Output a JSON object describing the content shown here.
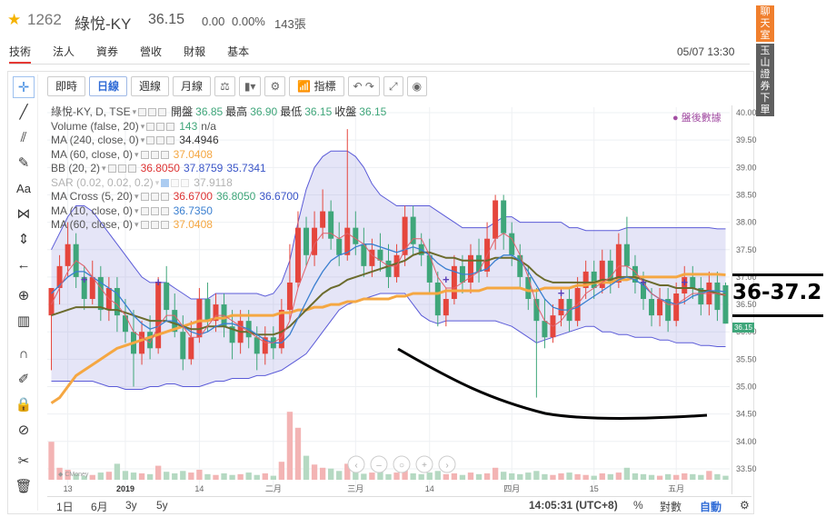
{
  "header": {
    "code": "1262",
    "name": "綠悅-KY",
    "price": "36.15",
    "change": "0.00",
    "pct": "0.00%",
    "volume": "143張",
    "datetime": "05/07 13:30"
  },
  "tabs": [
    "技術",
    "法人",
    "資券",
    "營收",
    "財報",
    "基本"
  ],
  "side_buttons": {
    "chat": "聊天室",
    "order": "玉山證券下單"
  },
  "toolbar": {
    "intraday": "即時",
    "daily": "日線",
    "weekly": "週線",
    "monthly": "月線",
    "indicator": "指標"
  },
  "legend": {
    "ohlc": {
      "title": "綠悅-KY, D, TSE",
      "open_l": "開盤",
      "open": "36.85",
      "high_l": "最高",
      "high": "36.90",
      "low_l": "最低",
      "low": "36.15",
      "close_l": "收盤",
      "close": "36.15"
    },
    "volume": {
      "label": "Volume (false, 20)",
      "v1": "143",
      "v2": "n/a"
    },
    "ma240": {
      "label": "MA (240, close, 0)",
      "v": "34.4946"
    },
    "ma60": {
      "label": "MA (60, close, 0)",
      "v": "37.0408"
    },
    "bb": {
      "label": "BB (20, 2)",
      "v1": "36.8050",
      "v2": "37.8759",
      "v3": "35.7341"
    },
    "sar": {
      "label": "SAR (0.02, 0.02, 0.2)",
      "v": "37.9118"
    },
    "macross": {
      "label": "MA Cross (5, 20)",
      "v1": "36.6700",
      "v2": "36.8050",
      "v3": "36.6700"
    },
    "ma10": {
      "label": "MA (10, close, 0)",
      "v": "36.7350"
    },
    "ma60b": {
      "label": "MA (60, close, 0)",
      "v": "37.0408"
    }
  },
  "post_market": "● 盤後數據",
  "price_axis": [
    "40.00",
    "39.50",
    "39.00",
    "38.50",
    "38.00",
    "37.50",
    "37.00",
    "36.50",
    "36.00",
    "35.50",
    "35.00",
    "34.50",
    "34.00",
    "33.50"
  ],
  "last_price_tag": "36.15",
  "time_axis": [
    "13",
    "2019",
    "14",
    "二月",
    "三月",
    "14",
    "四月",
    "15",
    "五月"
  ],
  "bottom": {
    "r1": "1日",
    "r2": "6月",
    "r3": "3y",
    "r4": "5y",
    "clock": "14:05:31 (UTC+8)",
    "pct": "%",
    "log": "對數",
    "auto": "自動"
  },
  "annotation": "36-37.2",
  "chart_data": {
    "type": "candlestick",
    "ylim": [
      33.3,
      40.1
    ],
    "candles": [
      [
        36.3,
        36.8,
        36.8,
        35.3
      ],
      [
        36.8,
        37.2,
        37.4,
        36.5
      ],
      [
        37.2,
        37.6,
        38.0,
        37.0
      ],
      [
        37.6,
        37.0,
        37.8,
        36.8
      ],
      [
        37.0,
        36.6,
        37.2,
        36.4
      ],
      [
        36.6,
        37.0,
        37.3,
        36.5
      ],
      [
        37.0,
        36.4,
        37.2,
        36.2
      ],
      [
        36.4,
        36.8,
        37.0,
        36.2
      ],
      [
        36.8,
        36.3,
        37.0,
        36.0
      ],
      [
        36.3,
        36.0,
        36.6,
        35.8
      ],
      [
        36.0,
        35.6,
        36.4,
        35.0
      ],
      [
        35.6,
        36.0,
        36.2,
        35.4
      ],
      [
        36.0,
        35.7,
        36.3,
        35.5
      ],
      [
        35.7,
        36.9,
        37.0,
        35.6
      ],
      [
        36.9,
        36.4,
        37.2,
        36.2
      ],
      [
        36.4,
        36.0,
        36.7,
        35.9
      ],
      [
        36.0,
        35.5,
        36.3,
        35.3
      ],
      [
        35.5,
        35.9,
        36.2,
        35.4
      ],
      [
        35.9,
        36.6,
        36.8,
        35.8
      ],
      [
        36.6,
        36.2,
        36.9,
        36.0
      ],
      [
        36.2,
        36.5,
        36.7,
        36.0
      ],
      [
        36.5,
        36.1,
        36.7,
        35.9
      ],
      [
        36.1,
        35.8,
        36.4,
        35.5
      ],
      [
        35.8,
        36.2,
        36.4,
        35.6
      ],
      [
        36.2,
        35.9,
        36.4,
        35.7
      ],
      [
        35.9,
        35.6,
        36.1,
        35.3
      ],
      [
        35.6,
        35.9,
        36.1,
        35.4
      ],
      [
        35.9,
        35.7,
        36.1,
        35.5
      ],
      [
        35.7,
        36.4,
        36.6,
        35.6
      ],
      [
        36.4,
        36.9,
        37.6,
        36.2
      ],
      [
        36.9,
        37.9,
        38.2,
        36.8
      ],
      [
        37.9,
        37.4,
        38.1,
        37.2
      ],
      [
        37.4,
        37.9,
        38.2,
        37.2
      ],
      [
        37.9,
        38.2,
        38.6,
        37.7
      ],
      [
        38.2,
        37.7,
        38.4,
        37.5
      ],
      [
        37.7,
        37.4,
        38.0,
        37.2
      ],
      [
        37.4,
        37.9,
        39.7,
        37.3
      ],
      [
        37.9,
        37.6,
        38.2,
        37.4
      ],
      [
        37.6,
        37.2,
        37.9,
        37.0
      ],
      [
        37.2,
        37.5,
        37.7,
        37.0
      ],
      [
        37.5,
        37.3,
        37.8,
        37.1
      ],
      [
        37.3,
        37.0,
        37.6,
        36.8
      ],
      [
        37.0,
        37.4,
        37.6,
        36.9
      ],
      [
        37.4,
        38.1,
        38.3,
        37.2
      ],
      [
        38.1,
        37.6,
        38.3,
        37.4
      ],
      [
        37.6,
        37.4,
        37.8,
        37.2
      ],
      [
        37.4,
        36.9,
        37.7,
        36.7
      ],
      [
        36.9,
        36.3,
        37.1,
        36.1
      ],
      [
        36.3,
        36.6,
        36.8,
        36.1
      ],
      [
        36.6,
        37.2,
        37.4,
        36.5
      ],
      [
        37.2,
        36.9,
        37.4,
        36.7
      ],
      [
        36.9,
        37.4,
        37.6,
        36.7
      ],
      [
        37.4,
        37.1,
        37.7,
        36.9
      ],
      [
        37.1,
        37.7,
        38.0,
        37.0
      ],
      [
        37.7,
        38.4,
        38.5,
        37.5
      ],
      [
        38.4,
        37.8,
        38.5,
        37.5
      ],
      [
        37.8,
        37.4,
        38.0,
        37.2
      ],
      [
        37.4,
        37.0,
        37.6,
        36.8
      ],
      [
        37.0,
        36.6,
        37.2,
        36.4
      ],
      [
        36.6,
        36.2,
        36.8,
        34.8
      ],
      [
        36.2,
        35.9,
        36.6,
        35.7
      ],
      [
        35.9,
        36.3,
        36.5,
        35.8
      ],
      [
        36.3,
        36.6,
        36.8,
        36.1
      ],
      [
        36.6,
        36.2,
        36.8,
        36.0
      ],
      [
        36.2,
        36.8,
        37.0,
        36.1
      ],
      [
        36.8,
        37.1,
        37.3,
        36.6
      ],
      [
        37.1,
        36.8,
        37.3,
        36.6
      ],
      [
        36.8,
        37.3,
        37.5,
        36.7
      ],
      [
        37.3,
        36.9,
        37.5,
        36.7
      ],
      [
        36.9,
        37.6,
        37.8,
        36.8
      ],
      [
        37.6,
        37.2,
        38.1,
        37.0
      ],
      [
        37.2,
        36.9,
        37.4,
        36.7
      ],
      [
        36.9,
        36.6,
        37.1,
        36.4
      ],
      [
        36.6,
        36.3,
        36.8,
        36.1
      ],
      [
        36.3,
        36.6,
        36.8,
        36.1
      ],
      [
        36.6,
        36.2,
        36.8,
        36.0
      ],
      [
        36.2,
        36.7,
        36.9,
        36.1
      ],
      [
        36.7,
        37.0,
        37.2,
        36.5
      ],
      [
        37.0,
        36.8,
        37.2,
        36.6
      ],
      [
        36.8,
        36.5,
        37.0,
        36.3
      ],
      [
        36.5,
        36.9,
        37.1,
        36.3
      ],
      [
        36.9,
        36.4,
        37.1,
        36.2
      ],
      [
        36.85,
        36.15,
        36.9,
        36.15
      ]
    ],
    "ma_orange": [
      34.7,
      34.8,
      35.0,
      35.2,
      35.3,
      35.4,
      35.5,
      35.6,
      35.7,
      35.75,
      35.8,
      35.85,
      35.9,
      35.95,
      36.0,
      36.05,
      36.1,
      36.15,
      36.2,
      36.2,
      36.25,
      36.25,
      36.3,
      36.3,
      36.3,
      36.3,
      36.3,
      36.3,
      36.35,
      36.35,
      36.4,
      36.4,
      36.45,
      36.45,
      36.5,
      36.5,
      36.55,
      36.55,
      36.6,
      36.6,
      36.6,
      36.6,
      36.65,
      36.65,
      36.7,
      36.7,
      36.7,
      36.7,
      36.75,
      36.75,
      36.75,
      36.75,
      36.75,
      36.8,
      36.8,
      36.8,
      36.8,
      36.8,
      36.75,
      36.75,
      36.8,
      36.8,
      36.8,
      36.8,
      36.85,
      36.85,
      36.9,
      36.9,
      36.9,
      36.95,
      36.95,
      37.0,
      37.0,
      37.0,
      37.0,
      37.0,
      37.0,
      37.05,
      37.05,
      37.05,
      37.05,
      37.05,
      37.04
    ],
    "ma_olive": [
      36.3,
      36.35,
      36.4,
      36.45,
      36.45,
      36.45,
      36.45,
      36.4,
      36.4,
      36.35,
      36.3,
      36.25,
      36.2,
      36.2,
      36.2,
      36.15,
      36.1,
      36.05,
      36.05,
      36.1,
      36.1,
      36.1,
      36.05,
      36.0,
      36.0,
      35.95,
      35.95,
      35.95,
      36.0,
      36.1,
      36.25,
      36.4,
      36.55,
      36.7,
      36.8,
      36.85,
      36.95,
      37.0,
      37.05,
      37.1,
      37.15,
      37.2,
      37.25,
      37.3,
      37.4,
      37.45,
      37.45,
      37.4,
      37.35,
      37.35,
      37.3,
      37.3,
      37.3,
      37.3,
      37.35,
      37.35,
      37.35,
      37.3,
      37.2,
      37.05,
      36.95,
      36.9,
      36.9,
      36.9,
      36.9,
      36.9,
      36.9,
      36.95,
      36.95,
      37.0,
      37.0,
      37.0,
      36.95,
      36.9,
      36.85,
      36.85,
      36.8,
      36.8,
      36.8,
      36.75,
      36.75,
      36.7,
      36.67
    ],
    "ma_blue": [
      36.7,
      36.85,
      37.0,
      37.1,
      37.1,
      37.0,
      36.9,
      36.8,
      36.7,
      36.5,
      36.3,
      36.15,
      36.05,
      36.1,
      36.2,
      36.2,
      36.1,
      36.0,
      35.95,
      36.0,
      36.1,
      36.15,
      36.15,
      36.1,
      36.05,
      35.95,
      35.85,
      35.8,
      35.8,
      35.95,
      36.25,
      36.55,
      36.85,
      37.1,
      37.3,
      37.4,
      37.45,
      37.55,
      37.6,
      37.6,
      37.55,
      37.5,
      37.45,
      37.5,
      37.55,
      37.5,
      37.4,
      37.25,
      37.15,
      37.1,
      37.05,
      37.05,
      37.1,
      37.15,
      37.3,
      37.4,
      37.4,
      37.3,
      37.1,
      36.85,
      36.6,
      36.45,
      36.4,
      36.4,
      36.45,
      36.55,
      36.65,
      36.75,
      36.85,
      36.95,
      37.0,
      36.95,
      36.85,
      36.7,
      36.6,
      36.55,
      36.5,
      36.55,
      36.65,
      36.7,
      36.75,
      36.75,
      36.73
    ],
    "ma_red": [
      36.5,
      36.8,
      37.1,
      37.3,
      37.2,
      37.0,
      36.8,
      36.6,
      36.5,
      36.3,
      36.0,
      35.9,
      35.8,
      36.1,
      36.3,
      36.3,
      36.1,
      35.9,
      35.9,
      36.1,
      36.3,
      36.3,
      36.2,
      36.1,
      36.0,
      35.9,
      35.8,
      35.8,
      35.9,
      36.2,
      36.8,
      37.2,
      37.6,
      37.8,
      37.8,
      37.7,
      37.8,
      37.7,
      37.6,
      37.4,
      37.3,
      37.2,
      37.2,
      37.5,
      37.7,
      37.7,
      37.4,
      37.0,
      36.8,
      36.8,
      36.9,
      37.0,
      37.1,
      37.4,
      37.7,
      37.8,
      37.7,
      37.4,
      37.0,
      36.5,
      36.2,
      36.1,
      36.2,
      36.4,
      36.5,
      36.7,
      36.8,
      36.9,
      37.0,
      37.2,
      37.2,
      37.1,
      36.9,
      36.7,
      36.6,
      36.5,
      36.5,
      36.6,
      36.7,
      36.7,
      36.7,
      36.7,
      36.67
    ],
    "bb_upper": [
      37.5,
      37.8,
      38.1,
      38.3,
      38.3,
      38.2,
      38.0,
      37.8,
      37.6,
      37.4,
      37.2,
      37.0,
      36.9,
      36.9,
      36.9,
      36.8,
      36.7,
      36.6,
      36.6,
      36.6,
      36.7,
      36.7,
      36.7,
      36.7,
      36.7,
      36.7,
      36.65,
      36.7,
      36.9,
      37.3,
      38.0,
      38.6,
      39.0,
      39.2,
      39.3,
      39.3,
      39.3,
      39.2,
      39.0,
      38.7,
      38.5,
      38.4,
      38.3,
      38.3,
      38.3,
      38.3,
      38.3,
      38.2,
      38.1,
      38.0,
      37.9,
      37.9,
      37.9,
      37.9,
      38.0,
      38.1,
      38.1,
      38.0,
      38.0,
      38.0,
      38.0,
      38.0,
      38.0,
      37.9,
      37.9,
      37.85,
      37.85,
      37.85,
      37.85,
      37.85,
      37.9,
      37.9,
      37.9,
      37.9,
      37.9,
      37.9,
      37.9,
      37.9,
      37.9,
      37.9,
      37.9,
      37.88,
      37.88
    ],
    "bb_lower": [
      35.1,
      35.1,
      35.1,
      35.1,
      35.1,
      35.1,
      35.05,
      35.0,
      35.0,
      34.95,
      34.95,
      34.95,
      35.0,
      35.0,
      35.05,
      35.05,
      35.0,
      35.0,
      35.0,
      35.05,
      35.1,
      35.1,
      35.15,
      35.15,
      35.15,
      35.2,
      35.2,
      35.25,
      35.3,
      35.4,
      35.5,
      35.6,
      35.8,
      36.0,
      36.2,
      36.4,
      36.5,
      36.55,
      36.6,
      36.65,
      36.7,
      36.7,
      36.7,
      36.7,
      36.5,
      36.3,
      36.2,
      36.15,
      36.2,
      36.2,
      36.2,
      36.2,
      36.2,
      36.2,
      36.2,
      36.15,
      36.1,
      36.0,
      35.9,
      35.8,
      35.85,
      35.9,
      35.95,
      36.0,
      36.05,
      36.1,
      36.1,
      36.0,
      36.0,
      35.95,
      35.95,
      35.9,
      35.9,
      35.9,
      35.85,
      35.85,
      35.8,
      35.8,
      35.8,
      35.75,
      35.75,
      35.73,
      35.73
    ],
    "volume": [
      95,
      30,
      25,
      15,
      10,
      12,
      18,
      20,
      40,
      22,
      18,
      16,
      14,
      35,
      20,
      16,
      22,
      18,
      25,
      14,
      12,
      16,
      12,
      14,
      18,
      12,
      16,
      10,
      45,
      170,
      130,
      60,
      38,
      30,
      28,
      22,
      40,
      20,
      15,
      18,
      22,
      14,
      18,
      25,
      16,
      14,
      18,
      22,
      14,
      16,
      12,
      18,
      14,
      16,
      30,
      20,
      16,
      14,
      18,
      22,
      14,
      12,
      16,
      18,
      14,
      12,
      10,
      16,
      14,
      18,
      30,
      16,
      14,
      12,
      10,
      14,
      12,
      16,
      14,
      12,
      22,
      14,
      10
    ]
  }
}
